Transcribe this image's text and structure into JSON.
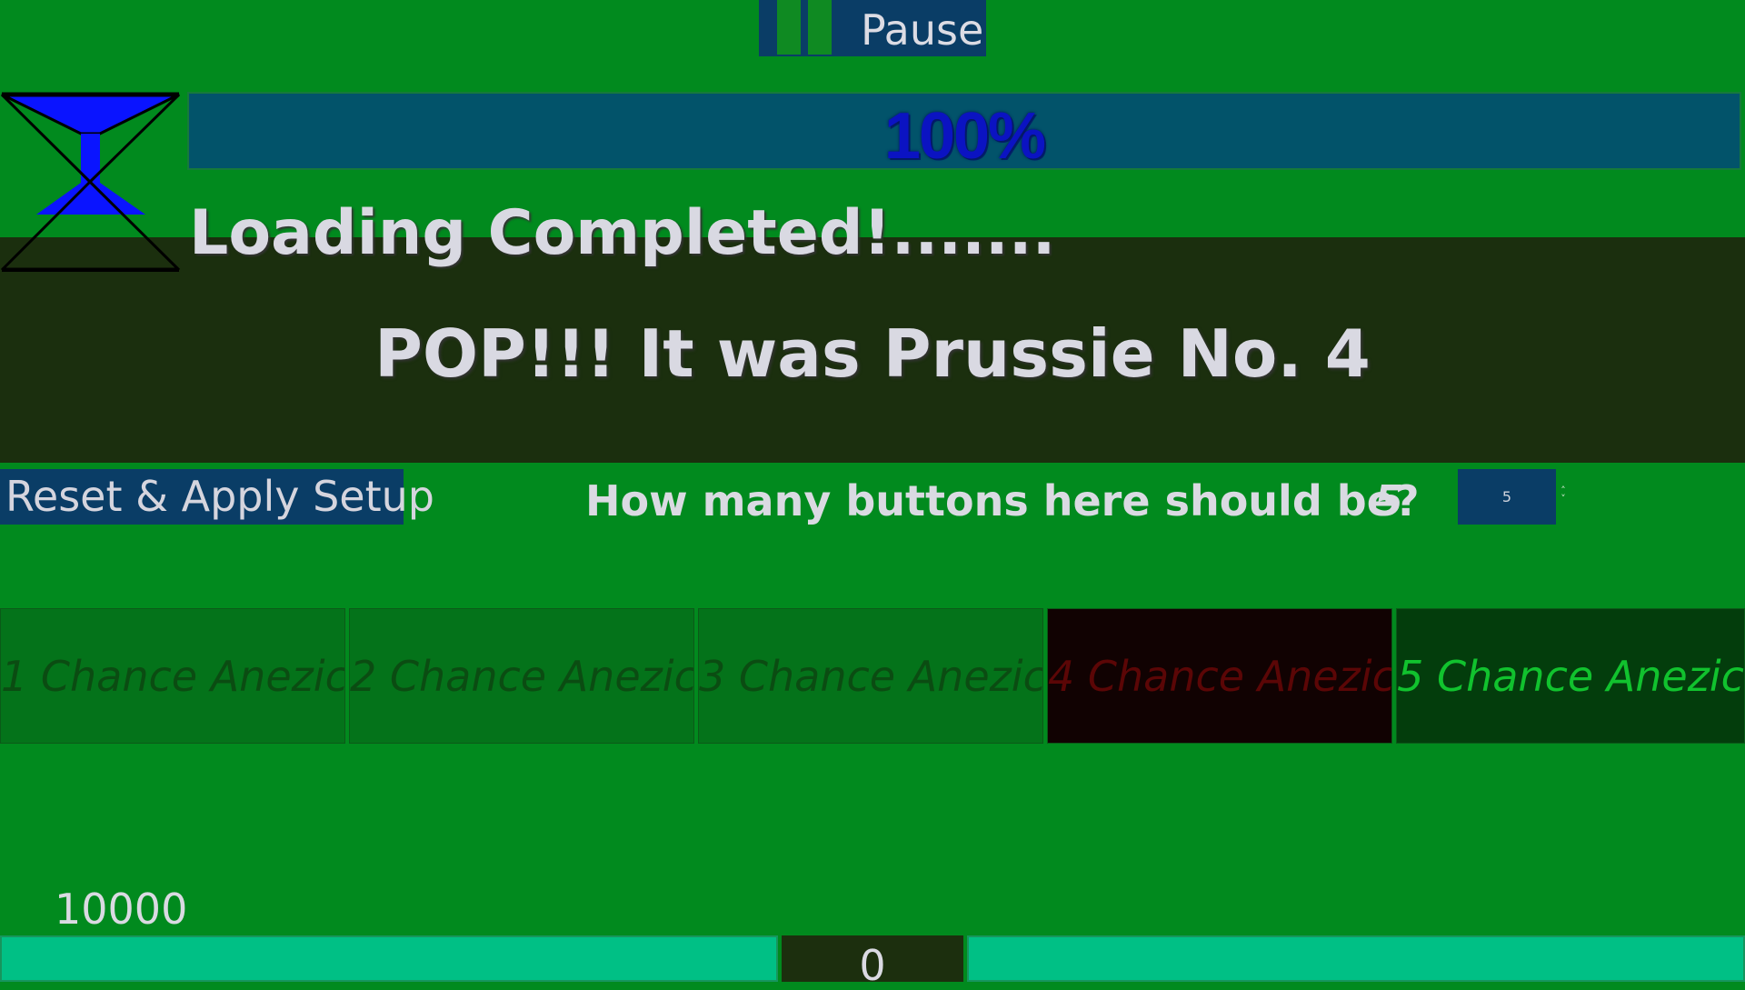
{
  "controls": {
    "pause_label": "Pause",
    "reset_label": "Reset & Apply Setup",
    "question": "How many buttons here should be?",
    "button_count_value": "5",
    "spinbox_value": "5"
  },
  "progress": {
    "percent_label": "100%",
    "fraction": 1.0,
    "status_text": "Loading Completed!......."
  },
  "result": {
    "message": "POP!!! It was Prussie No. 4"
  },
  "chance_buttons": [
    {
      "label": "1 Chance Anezic",
      "state": "normal",
      "bg": "#04731a",
      "fg": "#0b4c12"
    },
    {
      "label": "2 Chance Anezic",
      "state": "normal",
      "bg": "#04731a",
      "fg": "#0b4c12"
    },
    {
      "label": "3 Chance Anezic",
      "state": "normal",
      "bg": "#04731a",
      "fg": "#0b4c12"
    },
    {
      "label": "4 Chance Anezic",
      "state": "popped",
      "bg": "#110202",
      "fg": "#5b0606"
    },
    {
      "label": "5 Chance Anezic",
      "state": "active",
      "bg": "#033d0c",
      "fg": "#11c22e"
    }
  ],
  "stats": {
    "score": "10000",
    "counter": "0"
  },
  "colors": {
    "background": "#018a1e",
    "band": "#1b2f0e",
    "button": "#0a3d66",
    "progress_text": "#0b13c2",
    "bottom_bar": "#00c085"
  },
  "icons": {
    "pause": "pause-icon",
    "hourglass": "hourglass-icon"
  }
}
